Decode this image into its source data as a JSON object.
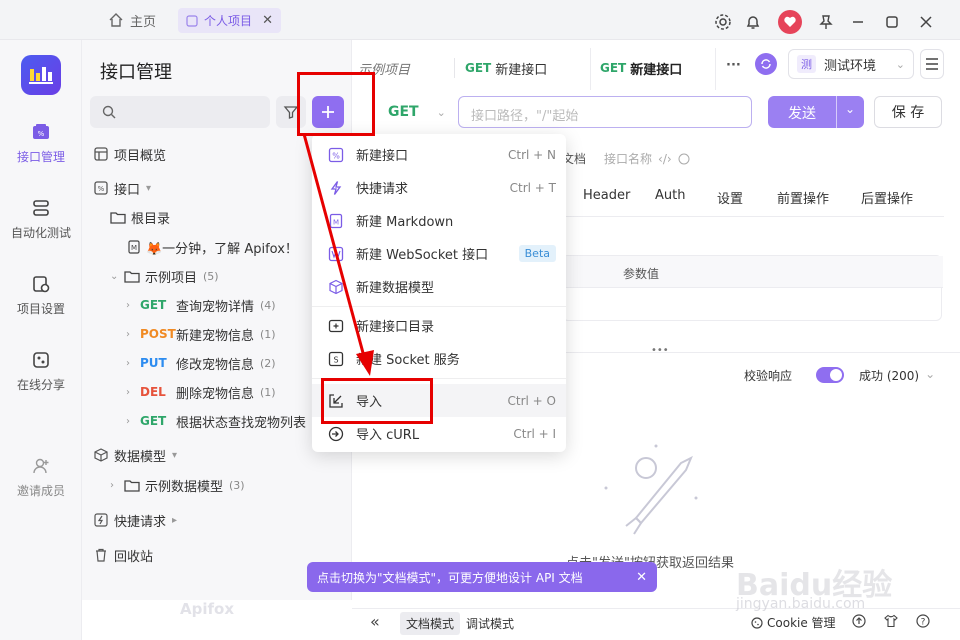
{
  "titlebar": {
    "home_tab": "主页",
    "project_tab": "个人项目",
    "close": "✕"
  },
  "rail": {
    "items": [
      {
        "label": "接口管理"
      },
      {
        "label": "自动化测试"
      },
      {
        "label": "项目设置"
      },
      {
        "label": "在线分享"
      },
      {
        "label": "邀请成员"
      }
    ]
  },
  "tree": {
    "title": "接口管理",
    "nodes": {
      "overview": "项目概览",
      "apis": "接口",
      "root": "根目录",
      "intro_doc": "🦊一分钟，了解 Apifox！",
      "example": "示例项目",
      "example_count": "(5)",
      "endpoints": [
        {
          "method": "GET",
          "name": "查询宠物详情",
          "count": "(4)"
        },
        {
          "method": "POST",
          "name": "新建宠物信息",
          "count": "(1)"
        },
        {
          "method": "PUT",
          "name": "修改宠物信息",
          "count": "(2)"
        },
        {
          "method": "DEL",
          "name": "删除宠物信息",
          "count": "(1)"
        },
        {
          "method": "GET",
          "name": "根据状态查找宠物列表",
          "count": ""
        }
      ],
      "models": "数据模型",
      "example_models": "示例数据模型",
      "example_models_count": "(3)",
      "quick_requests": "快捷请求",
      "recycle": "回收站"
    },
    "brand": "Apifox"
  },
  "main": {
    "tabs": [
      {
        "label": "示例项目"
      },
      {
        "method": "GET",
        "label": "新建接口"
      },
      {
        "method": "GET",
        "label": "新建接口"
      }
    ],
    "more": "···",
    "env": "测试环境",
    "env_badge": "测",
    "url": {
      "method": "GET",
      "placeholder": "接口路径，\"/\"起始"
    },
    "send": "发送",
    "save": "保 存",
    "doc_hint": "文档",
    "name_hint": "接口名称",
    "req_tabs": [
      "Header",
      "Auth",
      "设置",
      "前置操作",
      "后置操作"
    ],
    "param_header": "参数值",
    "validate": "校验响应",
    "status": "成功 (200)",
    "empty_hint": "点击\"发送\"按钮获取返回结果"
  },
  "menu": {
    "items": [
      {
        "label": "新建接口",
        "shortcut": "Ctrl + N"
      },
      {
        "label": "快捷请求",
        "shortcut": "Ctrl + T"
      },
      {
        "label": "新建 Markdown",
        "shortcut": ""
      },
      {
        "label": "新建 WebSocket 接口",
        "badge": "Beta"
      },
      {
        "label": "新建数据模型",
        "shortcut": ""
      },
      {
        "label": "新建接口目录",
        "shortcut": ""
      },
      {
        "label": "新建 Socket 服务",
        "shortcut": ""
      },
      {
        "label": "导入",
        "shortcut": "Ctrl + O"
      },
      {
        "label": "导入 cURL",
        "shortcut": "Ctrl + I"
      }
    ]
  },
  "tip": {
    "text": "点击切换为\"文档模式\"，可更方便地设计 API 文档",
    "close": "✕"
  },
  "bottom": {
    "collapse": "«",
    "doc_mode": "文档模式",
    "debug_mode": "调试模式",
    "cookie": "Cookie 管理"
  },
  "watermark": {
    "brand": "Baidu经验",
    "url": "jingyan.baidu.com"
  }
}
